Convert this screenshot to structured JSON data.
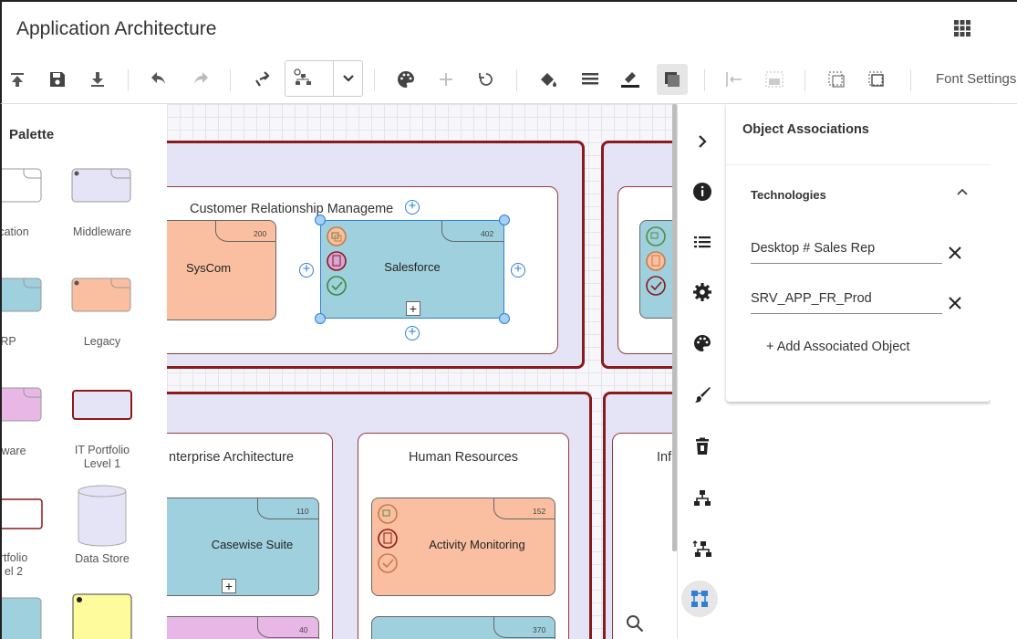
{
  "header": {
    "title": "Application Architecture"
  },
  "toolbar": {
    "font_settings": "Font Settings"
  },
  "palette": {
    "title": "Palette",
    "items": [
      {
        "label": "cation"
      },
      {
        "label": "Middleware"
      },
      {
        "label": "RP"
      },
      {
        "label": "Legacy"
      },
      {
        "label": "ware"
      },
      {
        "label": "IT Portfolio\nLevel 1"
      },
      {
        "label": "rtfolio\nel 2"
      },
      {
        "label": "Data Store"
      }
    ]
  },
  "canvas": {
    "groups": {
      "crm": {
        "title": "Customer Relationship Manageme",
        "nodes": [
          {
            "label": "SysCom",
            "number": "200"
          },
          {
            "label": "Salesforce",
            "number": "402"
          }
        ]
      },
      "ea": {
        "title": "nterprise Architecture",
        "nodes": [
          {
            "label": "Casewise Suite",
            "number": "110"
          },
          {
            "label": "",
            "number": "40"
          }
        ]
      },
      "hr": {
        "title": "Human Resources",
        "nodes": [
          {
            "label": "Activity Monitoring",
            "number": "152"
          },
          {
            "label": "",
            "number": "370"
          }
        ]
      },
      "inf": {
        "title": "Inf"
      }
    }
  },
  "side_panel": {
    "title": "Object Associations",
    "section_title": "Technologies",
    "associations": [
      "Desktop # Sales Rep",
      "SRV_APP_FR_Prod"
    ],
    "add_label": "+ Add Associated Object"
  },
  "colors": {
    "group_border": "#8b1a1a",
    "group_fill": "#e4e4f6",
    "node_orange": "#f9bfa0",
    "node_blue": "#9fd0dd",
    "node_pink": "#e9b7e5",
    "node_yellow": "#fdfb9c",
    "selection": "#2f7fd6"
  }
}
